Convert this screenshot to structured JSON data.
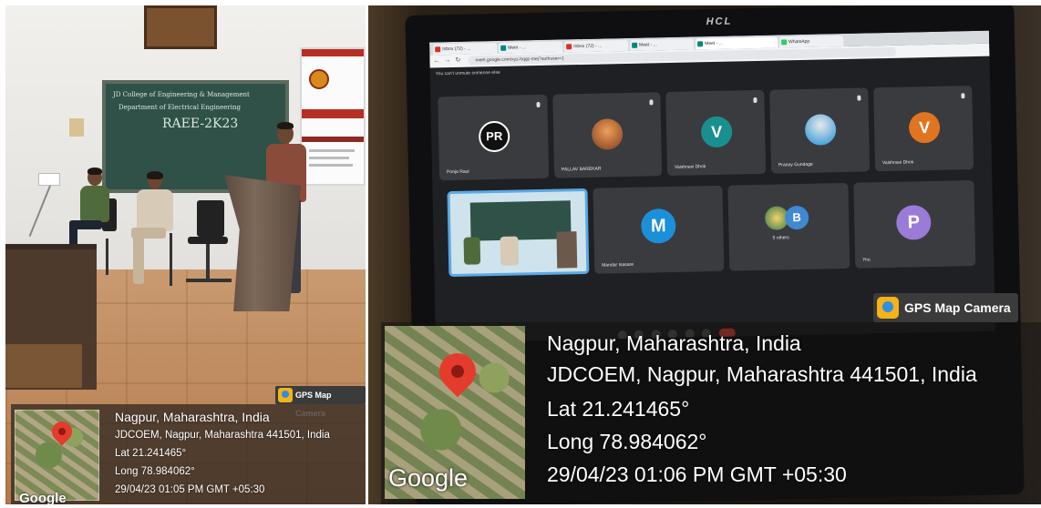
{
  "left_photo": {
    "chalkboard_lines": [
      "JD College of Engineering & Management",
      "Department of Electrical Engineering",
      "RAEE-2K23"
    ],
    "gps_tag": "GPS Map Camera",
    "map_provider": "Google",
    "location": {
      "city": "Nagpur, Maharashtra, India",
      "address": "JDCOEM, Nagpur, Maharashtra 441501, India",
      "lat": "Lat 21.241465°",
      "long": "Long 78.984062°",
      "datetime": "29/04/23 01:05 PM GMT +05:30"
    }
  },
  "right_photo": {
    "monitor_brand": "HCL",
    "browser": {
      "tabs": [
        "Inbox (72) - ...",
        "Meet - ...",
        "Inbox (72) - ...",
        "Meet - ...",
        "Meet - ...",
        "WhatsApp"
      ],
      "url": "meet.google.com/xyz-hqgz-mej?authuser=1"
    },
    "meet": {
      "notice": "You can't unmute someone else",
      "participants": [
        {
          "name": "Pooja Raut",
          "initial": "PR"
        },
        {
          "name": "PALLAV BAREKAR",
          "initial": ""
        },
        {
          "name": "Vaishnavi Dhok",
          "initial": "V"
        },
        {
          "name": "Pranay Gundage",
          "initial": ""
        },
        {
          "name": "Vaishnavi Dhok",
          "initial": "V"
        },
        {
          "name": "Mandar Isasare",
          "initial": "M"
        },
        {
          "name": "5 others",
          "initial": "B"
        },
        {
          "name": "You",
          "initial": "P"
        }
      ],
      "avatar_colors": {
        "teal": "#1a8f8f",
        "orange": "#e0741f",
        "sky": "#1c8fd9",
        "purple": "#9a7bd8"
      }
    },
    "gps_tag": "GPS Map Camera",
    "map_provider": "Google",
    "location": {
      "city": "Nagpur, Maharashtra, India",
      "address": "JDCOEM, Nagpur, Maharashtra 441501, India",
      "lat": "Lat 21.241465°",
      "long": "Long 78.984062°",
      "datetime": "29/04/23 01:06 PM GMT +05:30"
    }
  }
}
